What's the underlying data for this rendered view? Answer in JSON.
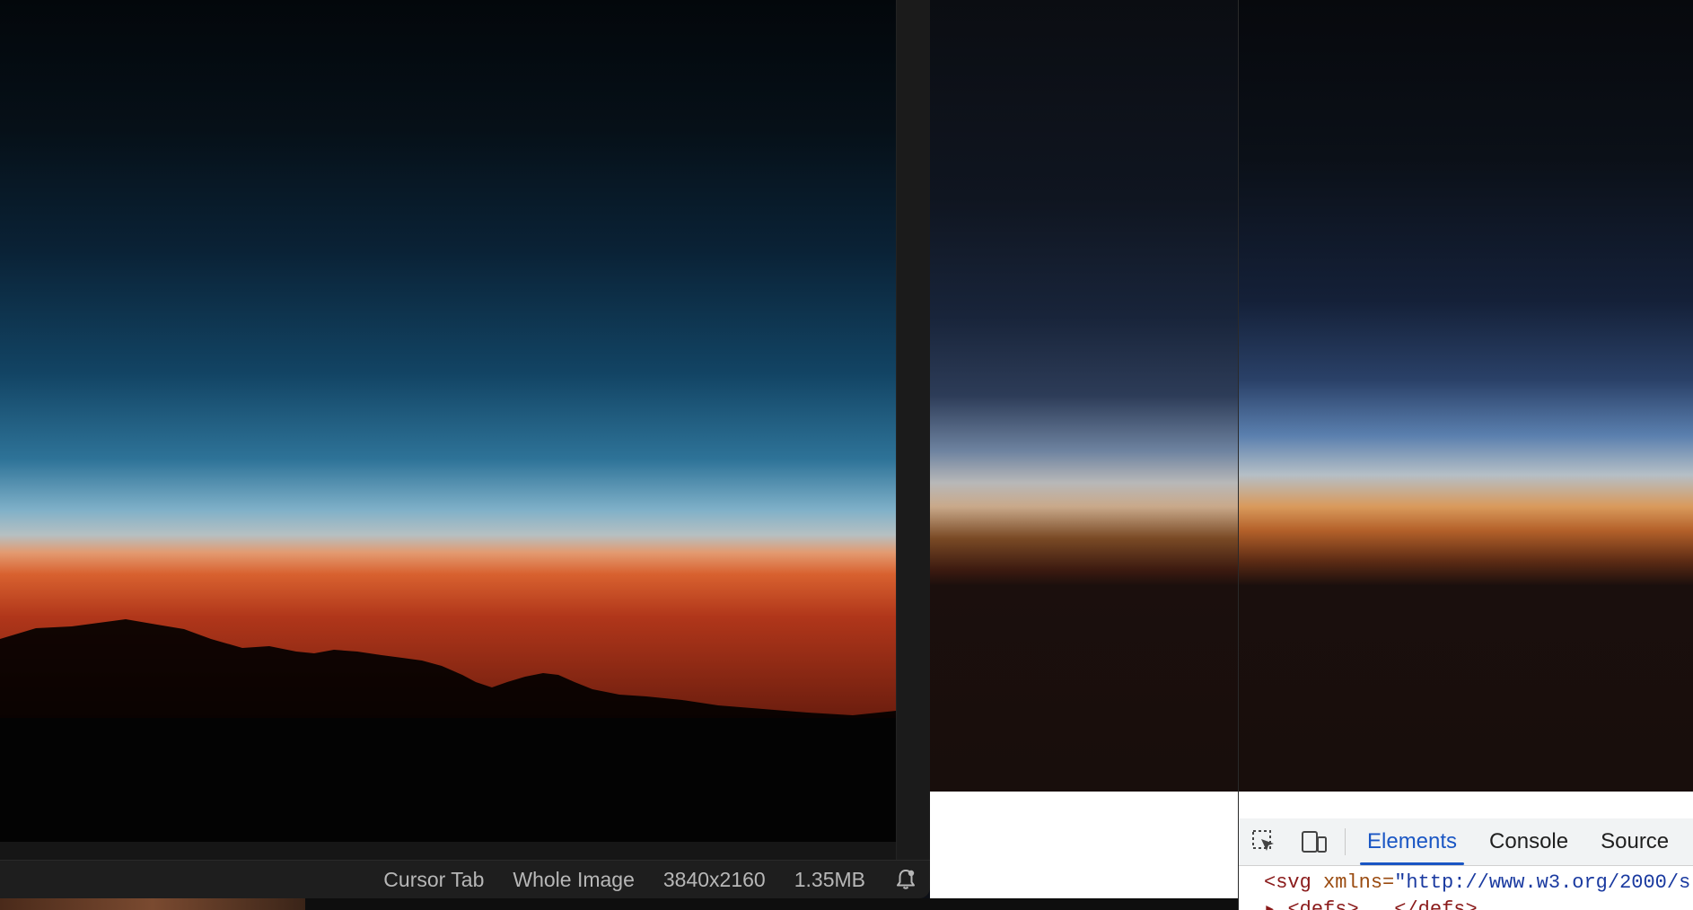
{
  "editor": {
    "status_bar": {
      "tool": "Cursor Tab",
      "scope": "Whole Image",
      "dimensions": "3840x2160",
      "file_size": "1.35MB",
      "notification_icon": "bell-icon"
    }
  },
  "devtools": {
    "tabs": [
      {
        "label": "Elements",
        "active": true
      },
      {
        "label": "Console",
        "active": false
      },
      {
        "label": "Source",
        "active": false
      }
    ],
    "toolbar_icons": [
      "inspect-element-icon",
      "device-toolbar-icon"
    ],
    "code": {
      "line1_tag_open": "<svg",
      "line1_attr": "xmlns",
      "line1_eq": "=",
      "line1_val": "\"http://www.w3.org/2000/s",
      "line2": "▸ <defs> … </defs>"
    },
    "colors": {
      "accent": "#1a56c4",
      "tag": "#8a1a1a",
      "attr": "#9a4b10",
      "value": "#1a3aa0"
    }
  }
}
